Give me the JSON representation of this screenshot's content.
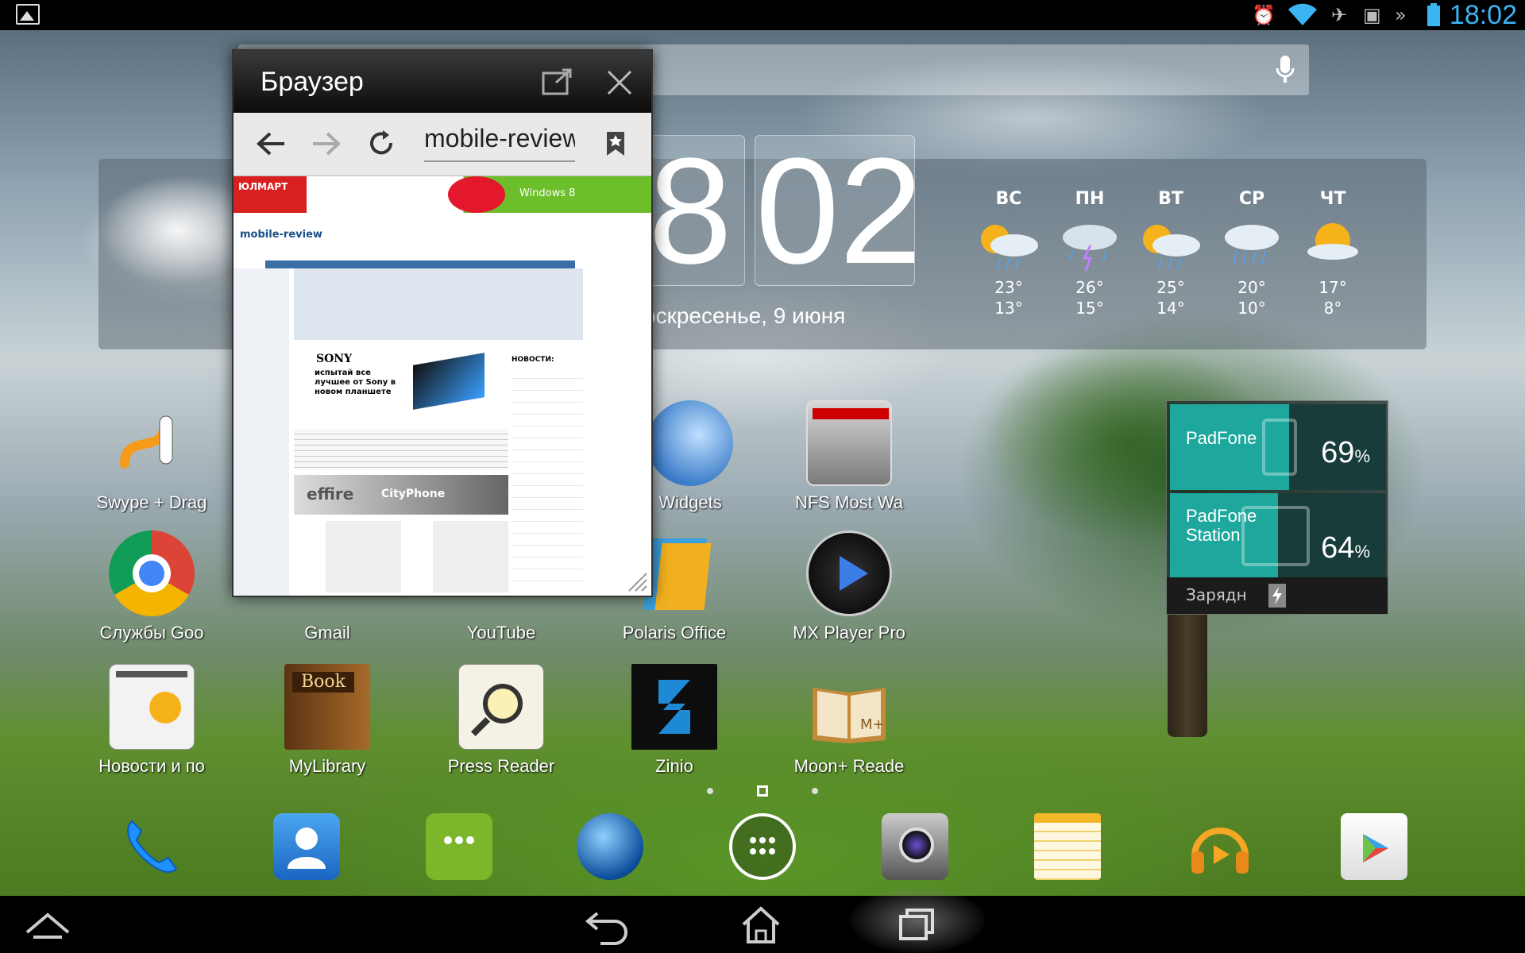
{
  "status_bar": {
    "time": "18:02",
    "icons": [
      "gallery-icon",
      "alarm-icon",
      "wifi-icon",
      "airplane-icon",
      "screen-mirror-icon",
      "battery-icon"
    ]
  },
  "search": {
    "icon": "mic-icon"
  },
  "clock": {
    "hour_digit": "8",
    "minutes": "02",
    "date": "оскресенье, 9 июня"
  },
  "weather": {
    "forecast": [
      {
        "day": "ВС",
        "hi": "23°",
        "lo": "13°",
        "icon": "sun-rain-icon"
      },
      {
        "day": "ПН",
        "hi": "26°",
        "lo": "15°",
        "icon": "thunderstorm-icon"
      },
      {
        "day": "ВТ",
        "hi": "25°",
        "lo": "14°",
        "icon": "sun-rain-icon"
      },
      {
        "day": "СР",
        "hi": "20°",
        "lo": "10°",
        "icon": "rain-icon"
      },
      {
        "day": "ЧТ",
        "hi": "17°",
        "lo": "8°",
        "icon": "sun-cloud-icon"
      }
    ]
  },
  "browser_window": {
    "title": "Браузер",
    "url": "mobile-review",
    "page_texts": [
      "ЮЛМАРТ",
      "Windows 8",
      "mobile-review",
      "SONY",
      "испытай все лучшее от Sony в новом планшете",
      "effire",
      "CityPhone",
      "НОВОСТИ:"
    ]
  },
  "apps_row1": [
    {
      "label": "Swype + Drag",
      "icon": "swype-icon"
    },
    {
      "label": "Widgets",
      "icon": "widgets-icon"
    },
    {
      "label": "NFS Most Wa",
      "icon": "nfs-icon"
    }
  ],
  "apps_row2": [
    {
      "label": "Службы Goo",
      "icon": "chrome-icon"
    },
    {
      "label": "Gmail",
      "icon": "gmail-icon"
    },
    {
      "label": "YouTube",
      "icon": "youtube-icon"
    },
    {
      "label": "Polaris Office",
      "icon": "polaris-office-icon"
    },
    {
      "label": "MX Player Pro",
      "icon": "mx-player-icon"
    }
  ],
  "apps_row3": [
    {
      "label": "Новости и по",
      "icon": "google-news-icon"
    },
    {
      "label": "MyLibrary",
      "icon": "book-icon"
    },
    {
      "label": "Press Reader",
      "icon": "press-reader-icon"
    },
    {
      "label": "Zinio",
      "icon": "zinio-icon"
    },
    {
      "label": "Moon+ Reade",
      "icon": "moon-reader-icon"
    }
  ],
  "battery_widget": {
    "device1": {
      "name": "PadFone",
      "percent": "69",
      "unit": "%",
      "level": 0.69
    },
    "device2": {
      "name_line1": "PadFone",
      "name_line2": "Station",
      "percent": "64",
      "unit": "%",
      "level": 0.64
    },
    "status": "Зарядн"
  },
  "dock": [
    "phone-icon",
    "contacts-icon",
    "messaging-icon",
    "browser-globe-icon",
    "all-apps-icon",
    "camera-icon",
    "notes-icon",
    "music-icon",
    "play-store-icon"
  ],
  "navbar": [
    "up-icon",
    "back-icon",
    "home-icon",
    "recent-apps-icon"
  ],
  "colors": {
    "accent": "#3bb4f2",
    "battery_fill": "#1ea79c"
  }
}
